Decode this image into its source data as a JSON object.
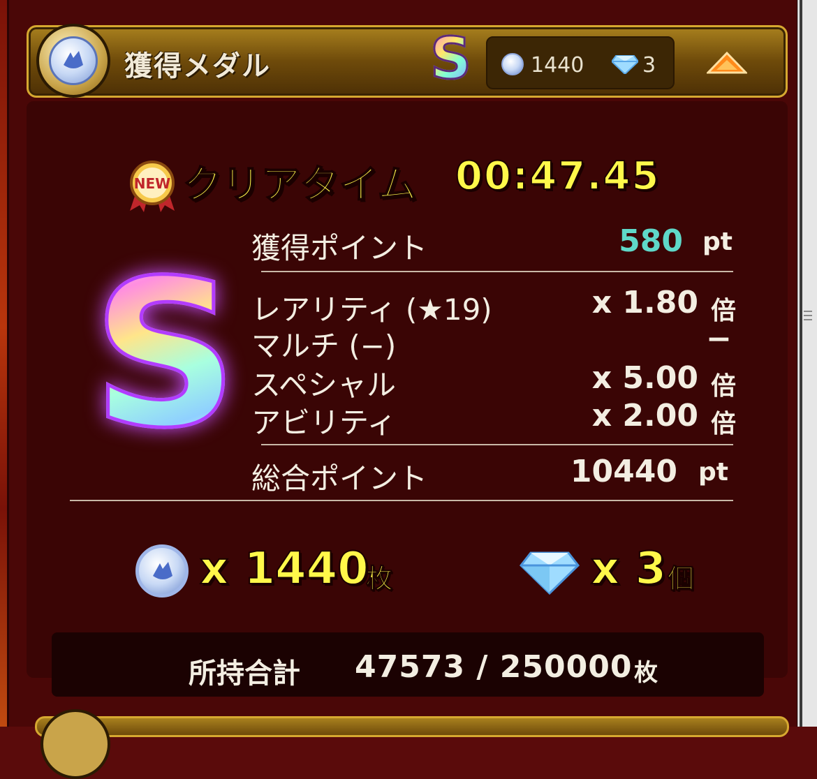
{
  "header": {
    "title": "獲得メダル",
    "rank": "S",
    "medal_count": "1440",
    "gem_count": "3"
  },
  "result": {
    "clear_label": "クリアタイム",
    "clear_time": "00:47.45",
    "new_badge": "NEW",
    "rank": "S",
    "rows": [
      {
        "label": "獲得ポイント",
        "value": "580",
        "unit": "pt"
      },
      {
        "label": "レアリティ (★19)",
        "value": "x 1.80",
        "unit": "倍"
      },
      {
        "label": "マルチ (−)",
        "value": "−",
        "unit": ""
      },
      {
        "label": "スペシャル",
        "value": "x 5.00",
        "unit": "倍"
      },
      {
        "label": "アビリティ",
        "value": "x 2.00",
        "unit": "倍"
      },
      {
        "label": "総合ポイント",
        "value": "10440",
        "unit": "pt"
      }
    ],
    "accent_color": "#5fd8c8"
  },
  "rewards": {
    "medal_amount": "x 1440",
    "medal_unit": "枚",
    "gem_amount": "x 3",
    "gem_unit": "個"
  },
  "total": {
    "label": "所持合計",
    "value": "47573 / 250000",
    "unit": "枚"
  },
  "icons": [
    "medal-icon",
    "gem-icon",
    "new-badge-icon",
    "collapse-arrow-icon"
  ]
}
